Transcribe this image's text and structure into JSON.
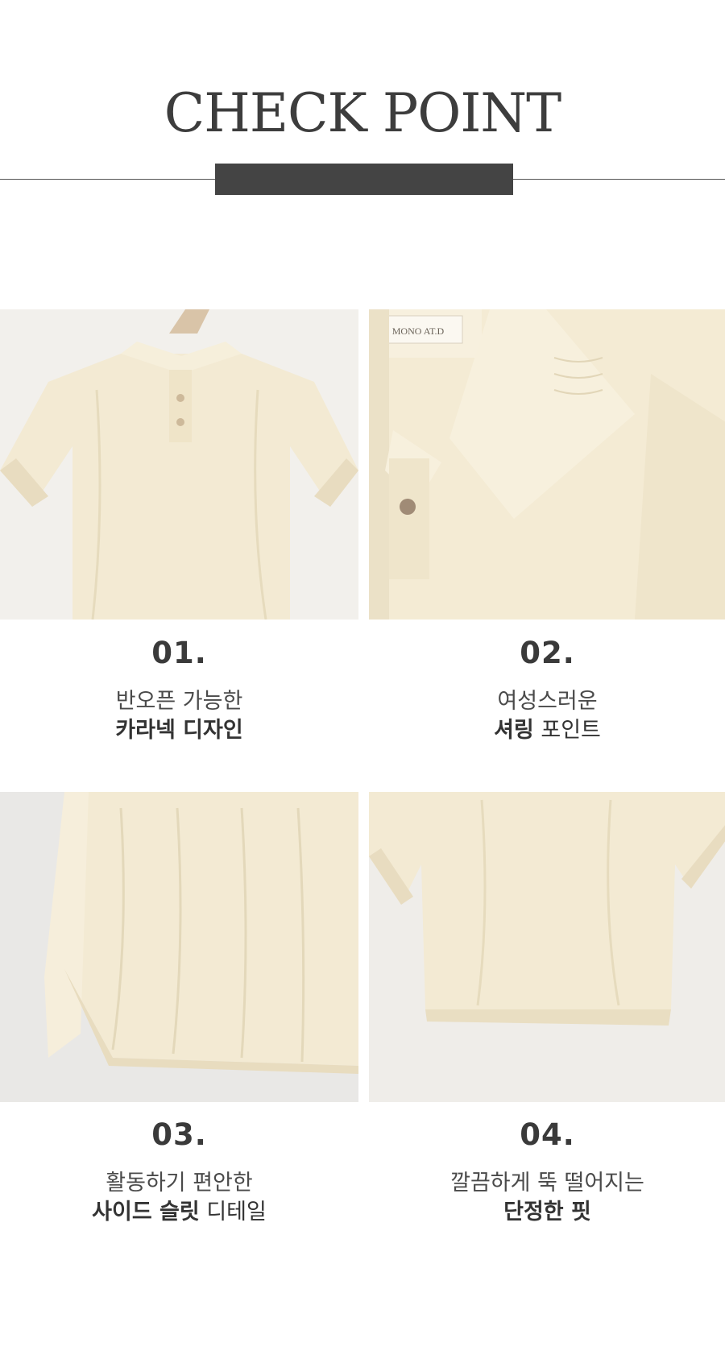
{
  "header": {
    "title": "CHECK POINT"
  },
  "points": [
    {
      "number": "01.",
      "line1": "반오픈 가능한",
      "line2_bold": "카라넥 디자인",
      "line2_rest": ""
    },
    {
      "number": "02.",
      "line1": "여성스러운",
      "line2_bold": "셔링",
      "line2_rest": " 포인트"
    },
    {
      "number": "03.",
      "line1": "활동하기 편안한",
      "line2_bold": "사이드 슬릿",
      "line2_rest": " 디테일"
    },
    {
      "number": "04.",
      "line1": "깔끔하게 뚝 떨어지는",
      "line2_bold": "단정한 핏",
      "line2_rest": ""
    }
  ],
  "label_text": "MONO AT.D",
  "colors": {
    "fabric": "#f3ead3",
    "fabric_shadow": "#e6dbbd",
    "backdrop": "#f1efec",
    "bar": "#444444"
  }
}
